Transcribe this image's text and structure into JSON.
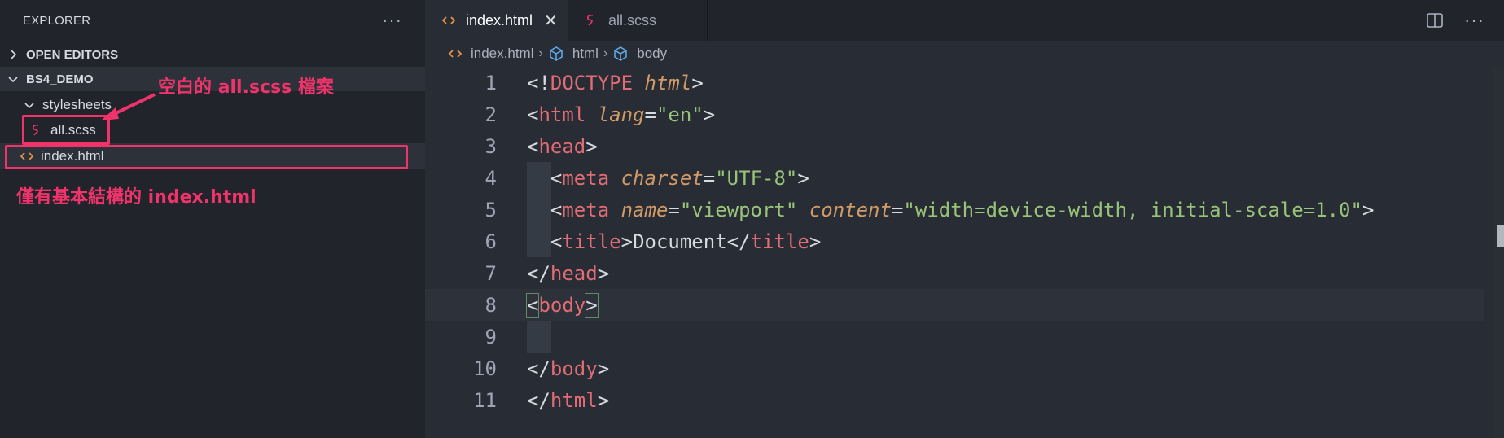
{
  "sidebar": {
    "title": "EXPLORER",
    "more": "···",
    "sections": {
      "open_editors": "OPEN EDITORS",
      "project": "BS4_DEMO"
    },
    "tree": {
      "folder": "stylesheets",
      "scss_file": "all.scss",
      "html_file": "index.html"
    }
  },
  "annotations": {
    "empty_scss": "空白的 all.scss 檔案",
    "basic_html": "僅有基本結構的 index.html",
    "color": "#f0336b"
  },
  "tabs": [
    {
      "label": "index.html",
      "active": true,
      "close": "✕"
    },
    {
      "label": "all.scss",
      "active": false
    }
  ],
  "editor_actions": {
    "more": "···"
  },
  "breadcrumb": [
    "index.html",
    "html",
    "body"
  ],
  "code": {
    "line_numbers": [
      "1",
      "2",
      "3",
      "4",
      "5",
      "6",
      "7",
      "8",
      "9",
      "10",
      "11"
    ],
    "current_line": 8,
    "tokens": {
      "l1": [
        "<!",
        "DOCTYPE",
        "html",
        ">"
      ],
      "l2": [
        "<",
        "html",
        "lang",
        "=",
        "\"en\"",
        ">"
      ],
      "l3": [
        "<",
        "head",
        ">"
      ],
      "l4": [
        "<",
        "meta",
        "charset",
        "=",
        "\"UTF-8\"",
        ">"
      ],
      "l5": [
        "<",
        "meta",
        "name",
        "=",
        "\"viewport\"",
        "content",
        "=",
        "\"width=device-width, initial-scale=1.0\"",
        ">"
      ],
      "l6": [
        "<",
        "title",
        ">",
        "Document",
        "</",
        "title",
        ">"
      ],
      "l7": [
        "</",
        "head",
        ">"
      ],
      "l8": [
        "<",
        "body",
        ">"
      ],
      "l10": [
        "</",
        "body",
        ">"
      ],
      "l11": [
        "</",
        "html",
        ">"
      ]
    }
  },
  "colors": {
    "tag": "#e06c75",
    "attribute": "#d19a66",
    "string": "#98c379",
    "scss_icon": "#f0336b",
    "html_icon": "#e5924a",
    "cube_icon": "#61afef"
  },
  "icons": {
    "html_file": "html-file-icon",
    "scss_file": "scss-file-icon",
    "symbol": "cube-icon",
    "split": "split-editor-icon"
  }
}
